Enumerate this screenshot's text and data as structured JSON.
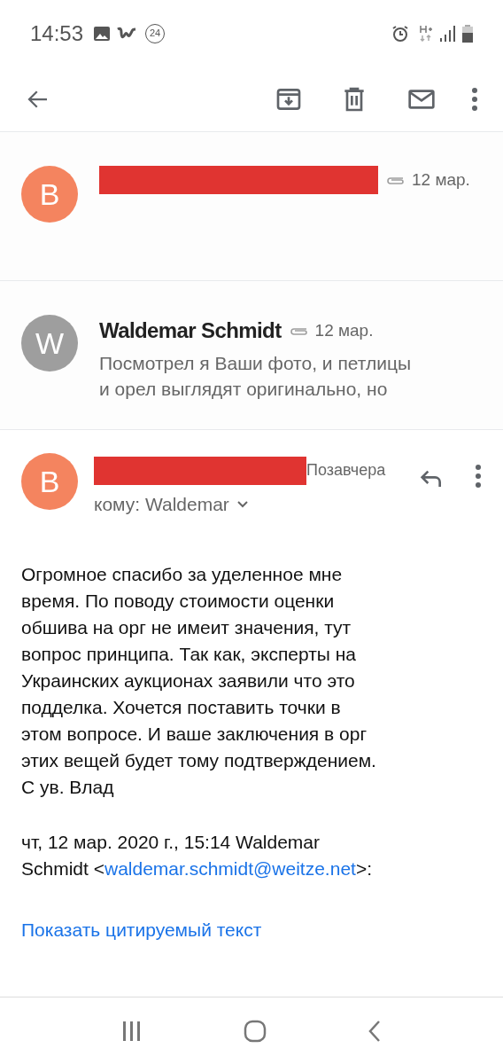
{
  "status_bar": {
    "time": "14:53",
    "badge": "24"
  },
  "messages": [
    {
      "avatar": "B",
      "color": "#f4845f",
      "sender_redacted": true,
      "attachment": true,
      "date": "12 мар."
    },
    {
      "avatar": "W",
      "color": "#9e9e9e",
      "sender": "Waldemar Schmidt",
      "sender_redacted": false,
      "attachment": true,
      "date": "12 мар.",
      "snippet": [
        "Посмотрел я Ваши фото, и петлицы",
        "и орел выглядят оригинально, но"
      ]
    }
  ],
  "open_message": {
    "avatar": "B",
    "color": "#f4845f",
    "date": "Позавчера",
    "recipient": "кому: Waldemar",
    "body": [
      "Огромное спасибо за уделенное мне",
      "время. По поводу стоимости оценки",
      "обшива на орг не имеит значения, тут",
      "вопрос принципа. Так как, эксперты на",
      "Украинских аукционах заявили что это",
      "подделка. Хочется поставить точки в",
      "этом вопросе. И ваше заключения в орг",
      "этих вещей будет тому подтверждением.",
      "С ув. Влад"
    ],
    "quote_header": "чт, 12 мар. 2020 г., 15:14 Waldemar",
    "quote_name": "Schmidt <",
    "quote_email": "waldemar.schmidt@weitze.net",
    "quote_end": ">:",
    "show_quoted": "Показать цитируемый текст"
  }
}
